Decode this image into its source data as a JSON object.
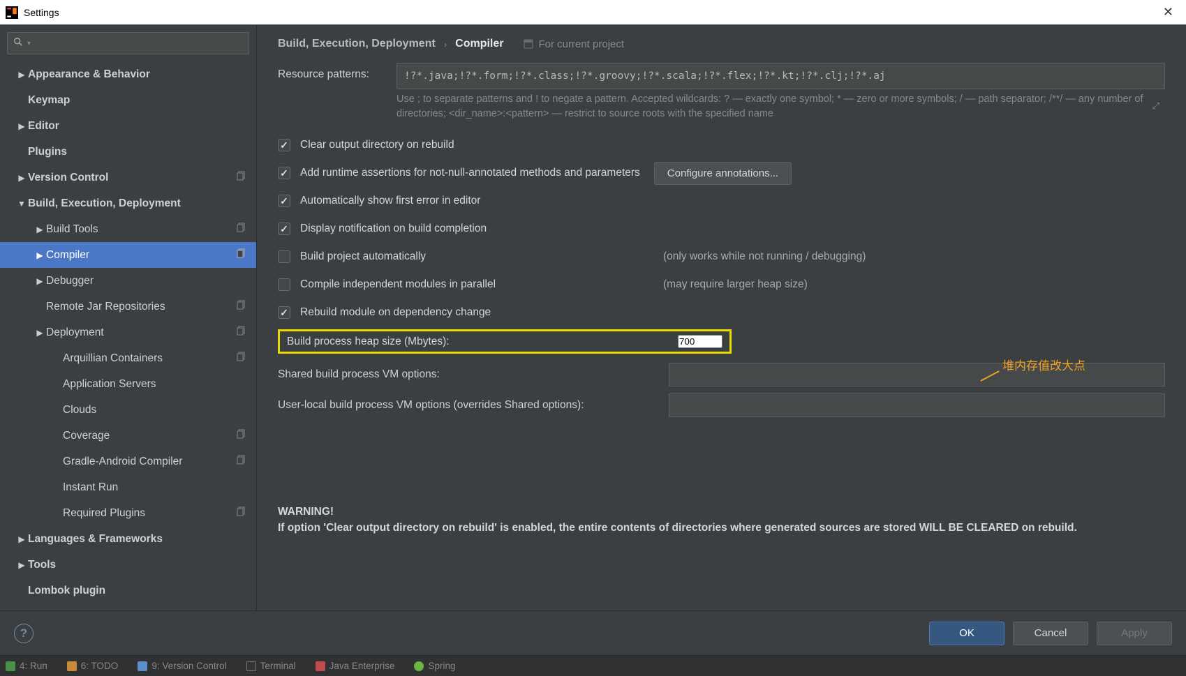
{
  "window": {
    "title": "Settings"
  },
  "sidebar": {
    "items": [
      {
        "label": "Appearance & Behavior",
        "depth": 0,
        "arrow": "▶",
        "bold": true
      },
      {
        "label": "Keymap",
        "depth": 0,
        "arrow": "",
        "bold": true
      },
      {
        "label": "Editor",
        "depth": 0,
        "arrow": "▶",
        "bold": true
      },
      {
        "label": "Plugins",
        "depth": 0,
        "arrow": "",
        "bold": true
      },
      {
        "label": "Version Control",
        "depth": 0,
        "arrow": "▶",
        "bold": true,
        "copy": true
      },
      {
        "label": "Build, Execution, Deployment",
        "depth": 0,
        "arrow": "▼",
        "bold": true
      },
      {
        "label": "Build Tools",
        "depth": 1,
        "arrow": "▶",
        "bold": false,
        "copy": true
      },
      {
        "label": "Compiler",
        "depth": 1,
        "arrow": "▶",
        "bold": false,
        "copy": true,
        "active": true
      },
      {
        "label": "Debugger",
        "depth": 1,
        "arrow": "▶",
        "bold": false
      },
      {
        "label": "Remote Jar Repositories",
        "depth": 1,
        "arrow": "",
        "bold": false,
        "copy": true
      },
      {
        "label": "Deployment",
        "depth": 1,
        "arrow": "▶",
        "bold": false,
        "copy": true
      },
      {
        "label": "Arquillian Containers",
        "depth": 2,
        "arrow": "",
        "bold": false,
        "copy": true
      },
      {
        "label": "Application Servers",
        "depth": 2,
        "arrow": "",
        "bold": false
      },
      {
        "label": "Clouds",
        "depth": 2,
        "arrow": "",
        "bold": false
      },
      {
        "label": "Coverage",
        "depth": 2,
        "arrow": "",
        "bold": false,
        "copy": true
      },
      {
        "label": "Gradle-Android Compiler",
        "depth": 2,
        "arrow": "",
        "bold": false,
        "copy": true
      },
      {
        "label": "Instant Run",
        "depth": 2,
        "arrow": "",
        "bold": false
      },
      {
        "label": "Required Plugins",
        "depth": 2,
        "arrow": "",
        "bold": false,
        "copy": true
      },
      {
        "label": "Languages & Frameworks",
        "depth": 0,
        "arrow": "▶",
        "bold": true
      },
      {
        "label": "Tools",
        "depth": 0,
        "arrow": "▶",
        "bold": true
      },
      {
        "label": "Lombok plugin",
        "depth": 0,
        "arrow": "",
        "bold": true
      }
    ]
  },
  "breadcrumb": {
    "parent": "Build, Execution, Deployment",
    "current": "Compiler",
    "scope": "For current project"
  },
  "compiler": {
    "resource_label": "Resource patterns:",
    "resource_value": "!?*.java;!?*.form;!?*.class;!?*.groovy;!?*.scala;!?*.flex;!?*.kt;!?*.clj;!?*.aj",
    "resource_help": "Use ; to separate patterns and ! to negate a pattern. Accepted wildcards: ? — exactly one symbol; * — zero or more symbols; / — path separator; /**/ — any number of directories; <dir_name>:<pattern> — restrict to source roots with the specified name",
    "checks": {
      "clear_output": {
        "label": "Clear output directory on rebuild",
        "checked": true
      },
      "runtime_assert": {
        "label": "Add runtime assertions for not-null-annotated methods and parameters",
        "checked": true,
        "button": "Configure annotations..."
      },
      "auto_first": {
        "label": "Automatically show first error in editor",
        "checked": true
      },
      "display_notify": {
        "label": "Display notification on build completion",
        "checked": true
      },
      "build_auto": {
        "label": "Build project automatically",
        "checked": false,
        "hint": "(only works while not running / debugging)"
      },
      "parallel": {
        "label": "Compile independent modules in parallel",
        "checked": false,
        "hint": "(may require larger heap size)"
      },
      "rebuild_dep": {
        "label": "Rebuild module on dependency change",
        "checked": true
      }
    },
    "heap_label": "Build process heap size (Mbytes):",
    "heap_value": "700",
    "shared_vm_label": "Shared build process VM options:",
    "shared_vm_value": "",
    "user_vm_label": "User-local build process VM options (overrides Shared options):",
    "user_vm_value": "",
    "warning_title": "WARNING!",
    "warning_body": "If option 'Clear output directory on rebuild' is enabled, the entire contents of directories where generated sources are stored WILL BE CLEARED on rebuild."
  },
  "annotation": "堆内存值改大点",
  "footer": {
    "ok": "OK",
    "cancel": "Cancel",
    "apply": "Apply"
  },
  "bottombar": {
    "run": "4: Run",
    "todo": "6: TODO",
    "vc": "9: Version Control",
    "terminal": "Terminal",
    "jee": "Java Enterprise",
    "spring": "Spring"
  }
}
